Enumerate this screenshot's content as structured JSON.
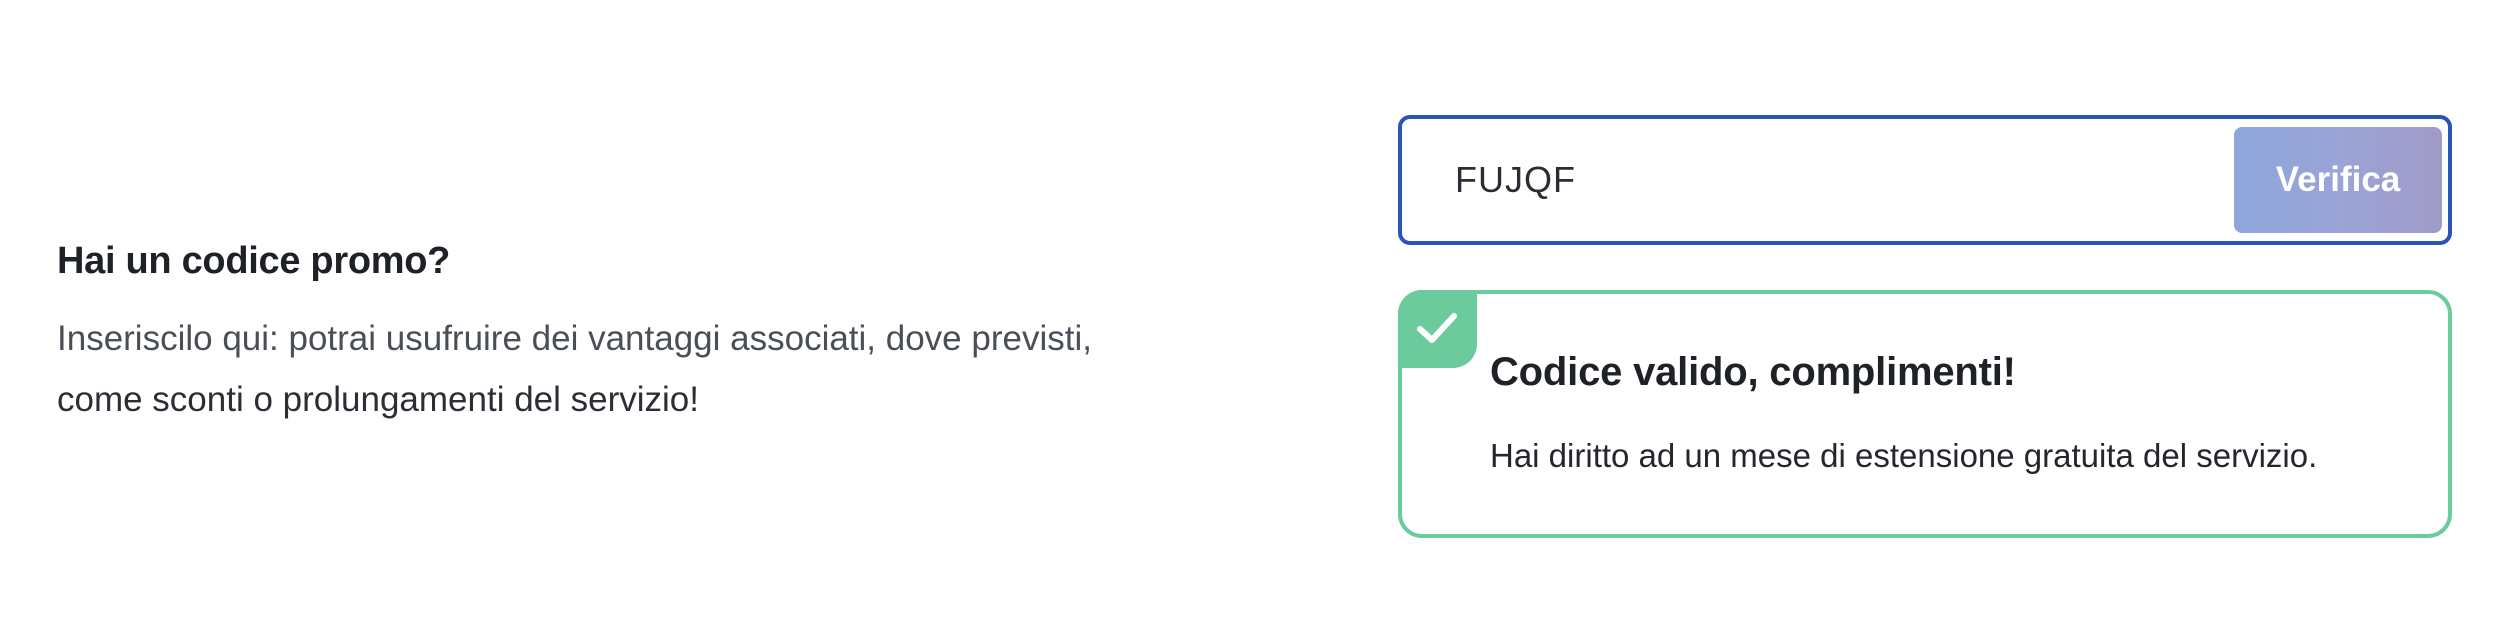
{
  "promo": {
    "title": "Hai un codice promo?",
    "description_line1": "Inseriscilo qui: potrai usufruire dei vantaggi associati, dove previsti,",
    "description_line2": "come sconti o prolungamenti del servizio!"
  },
  "code_form": {
    "input_value": "FUJQF",
    "verify_label": "Verifica"
  },
  "result": {
    "status": "success",
    "icon": "checkmark-icon",
    "title": "Codice valido, complimenti!",
    "message": "Hai diritto ad un mese di estensione gratuita del servizio."
  },
  "colors": {
    "input_border": "#2a55b8",
    "verify_button": "#95a3d9",
    "success": "#6bcb9d",
    "text": "#1e2126"
  }
}
